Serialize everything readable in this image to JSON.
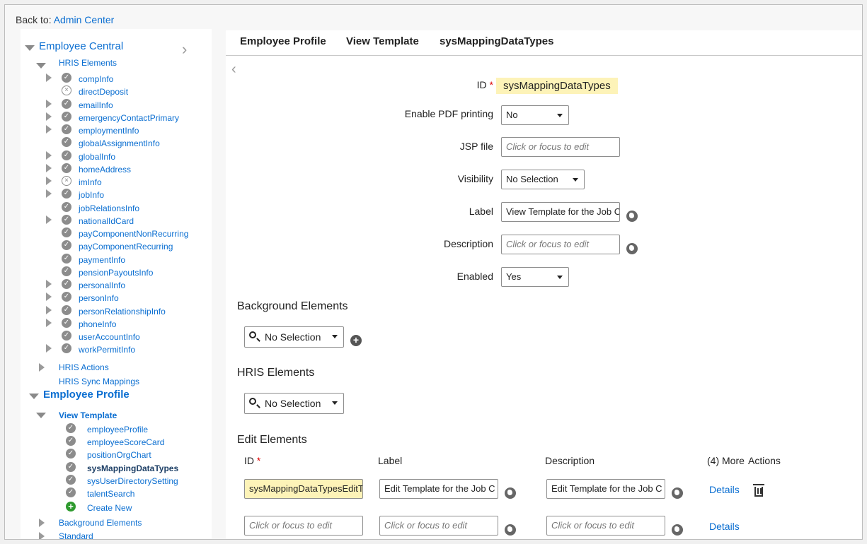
{
  "topbar": {
    "back_label": "Back to:",
    "back_link": "Admin Center"
  },
  "tree": {
    "employee_central": "Employee Central",
    "hris_elements": "HRIS Elements",
    "hris_items": [
      "compInfo",
      "directDeposit",
      "emailInfo",
      "emergencyContactPrimary",
      "employmentInfo",
      "globalAssignmentInfo",
      "globalInfo",
      "homeAddress",
      "imInfo",
      "jobInfo",
      "jobRelationsInfo",
      "nationalIdCard",
      "payComponentNonRecurring",
      "payComponentRecurring",
      "paymentInfo",
      "pensionPayoutsInfo",
      "personalInfo",
      "personInfo",
      "personRelationshipInfo",
      "phoneInfo",
      "userAccountInfo",
      "workPermitInfo"
    ],
    "hris_actions": "HRIS Actions",
    "hris_sync": "HRIS Sync Mappings",
    "employee_profile": "Employee Profile",
    "view_template": "View Template",
    "view_items": [
      "employeeProfile",
      "employeeScoreCard",
      "positionOrgChart",
      "sysMappingDataTypes",
      "sysUserDirectorySetting",
      "talentSearch"
    ],
    "create_new": "Create New",
    "background_elements": "Background Elements",
    "standard": "Standard"
  },
  "header": {
    "crumb1": "Employee Profile",
    "crumb2": "View Template",
    "crumb3": "sysMappingDataTypes"
  },
  "form": {
    "id_label": "ID",
    "id_required": "*",
    "id_value": "sysMappingDataTypes",
    "pdf_label": "Enable PDF printing",
    "pdf_value": "No",
    "jsp_label": "JSP file",
    "jsp_placeholder": "Click or focus to edit",
    "visibility_label": "Visibility",
    "visibility_value": "No Selection",
    "label_label": "Label",
    "label_value": "View Template for the Job C",
    "desc_label": "Description",
    "desc_placeholder": "Click or focus to edit",
    "enabled_label": "Enabled",
    "enabled_value": "Yes"
  },
  "background": {
    "title": "Background Elements",
    "select_value": "No Selection"
  },
  "hris": {
    "title": "HRIS Elements",
    "select_value": "No Selection"
  },
  "edit": {
    "title": "Edit Elements",
    "col_id": "ID",
    "col_id_required": "*",
    "col_label": "Label",
    "col_description": "Description",
    "col_more": "(4) More",
    "col_actions": "Actions",
    "row1": {
      "id": "sysMappingDataTypesEditT",
      "label": "Edit Template for the Job C",
      "description": "Edit Template for the Job C",
      "details": "Details"
    },
    "row2": {
      "id_placeholder": "Click or focus to edit",
      "label_placeholder": "Click or focus to edit",
      "description_placeholder": "Click or focus to edit",
      "details": "Details"
    }
  }
}
